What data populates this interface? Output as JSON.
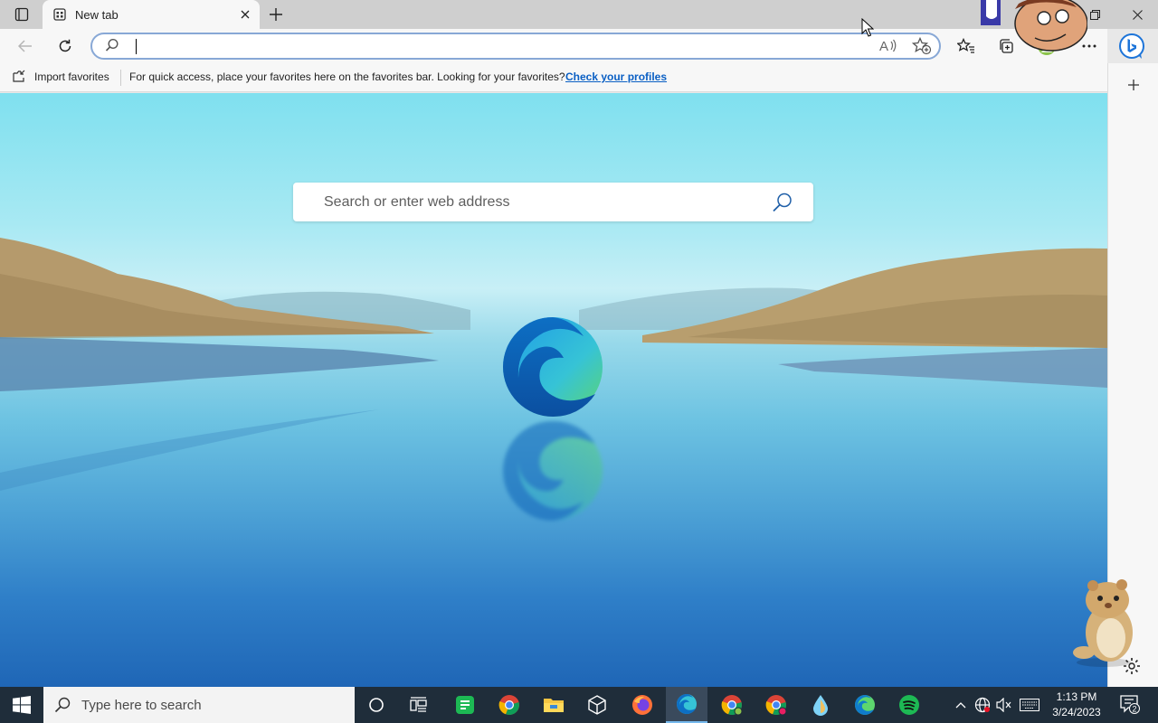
{
  "window": {
    "tab": {
      "title": "New tab",
      "icon": "new-tab-page-icon"
    },
    "buttons": [
      "tab-actions-icon",
      "new-tab-icon",
      "minimize-icon",
      "restore-icon",
      "close-icon"
    ]
  },
  "toolbar": {
    "address_value": "",
    "icons": [
      "back-icon",
      "refresh-icon",
      "search-icon",
      "read-aloud-icon",
      "add-favorite-icon",
      "favorites-icon",
      "collections-icon",
      "profile-icon",
      "more-icon",
      "bing-chat-icon"
    ]
  },
  "favorites_bar": {
    "import_label": "Import favorites",
    "message": "For quick access, place your favorites here on the favorites bar. Looking for your favorites?",
    "link": "Check your profiles"
  },
  "ntp": {
    "search_placeholder": "Search or enter web address"
  },
  "taskbar": {
    "search_placeholder": "Type here to search",
    "apps": [
      "cortana-icon",
      "task-view-icon",
      "sheets-icon",
      "chrome-icon",
      "file-explorer-icon",
      "3d-viewer-icon",
      "firefox-icon",
      "edge-icon",
      "chrome-profile-icon",
      "chrome-profile-2-icon",
      "water-drop-app-icon",
      "edge-beta-icon",
      "spotify-icon"
    ],
    "time": "1:13 PM",
    "date": "3/24/2023",
    "notification_count": "2"
  },
  "colors": {
    "accent": "#0a5fc4",
    "taskbar": "#1f2d3a",
    "active_tab": "#76b9ed"
  }
}
